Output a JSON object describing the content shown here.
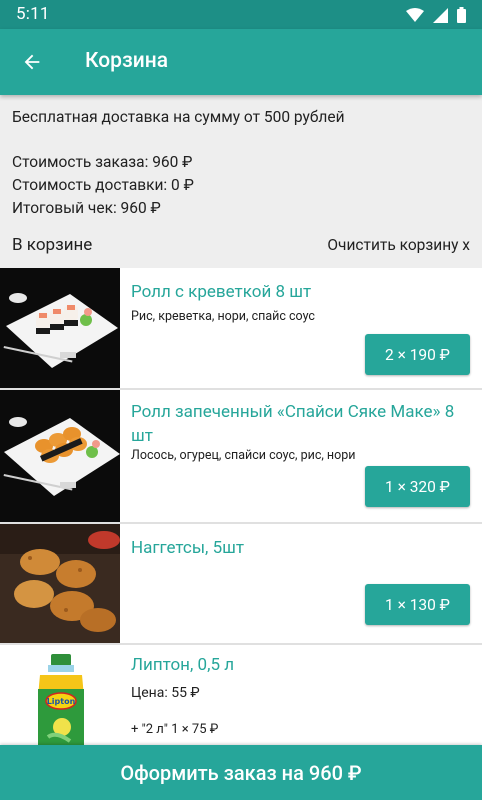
{
  "status_bar": {
    "time": "5:11"
  },
  "app_bar": {
    "title": "Корзина"
  },
  "summary": {
    "free_delivery": "Бесплатная доставка на сумму от 500 рублей",
    "order_cost": "Стоимость заказа: 960 ₽",
    "delivery_cost": "Стоимость доставки: 0 ₽",
    "total": "Итоговый чек: 960 ₽",
    "in_cart": "В корзине",
    "clear_cart": "Очистить корзину x"
  },
  "items": [
    {
      "name": "Ролл с креветкой 8 шт",
      "desc": "Рис, креветка, нори, спайс соус",
      "price": "2 × 190 ₽"
    },
    {
      "name": "Ролл запеченный «Спайси Сяке Маке» 8 шт",
      "desc": "Лосось, огурец, спайси соус, рис, нори",
      "price": "1 × 320 ₽"
    },
    {
      "name": "Наггетсы, 5шт",
      "price": "1 × 130 ₽"
    },
    {
      "name": "Липтон, 0,5 л",
      "unit_price": "Цена: 55 ₽",
      "option": "+ \"2 л\" 1 × 75 ₽"
    }
  ],
  "checkout": {
    "label": "Оформить заказ на 960 ₽"
  },
  "colors": {
    "primary": "#26a69a",
    "status_bar": "#1d8f86"
  }
}
